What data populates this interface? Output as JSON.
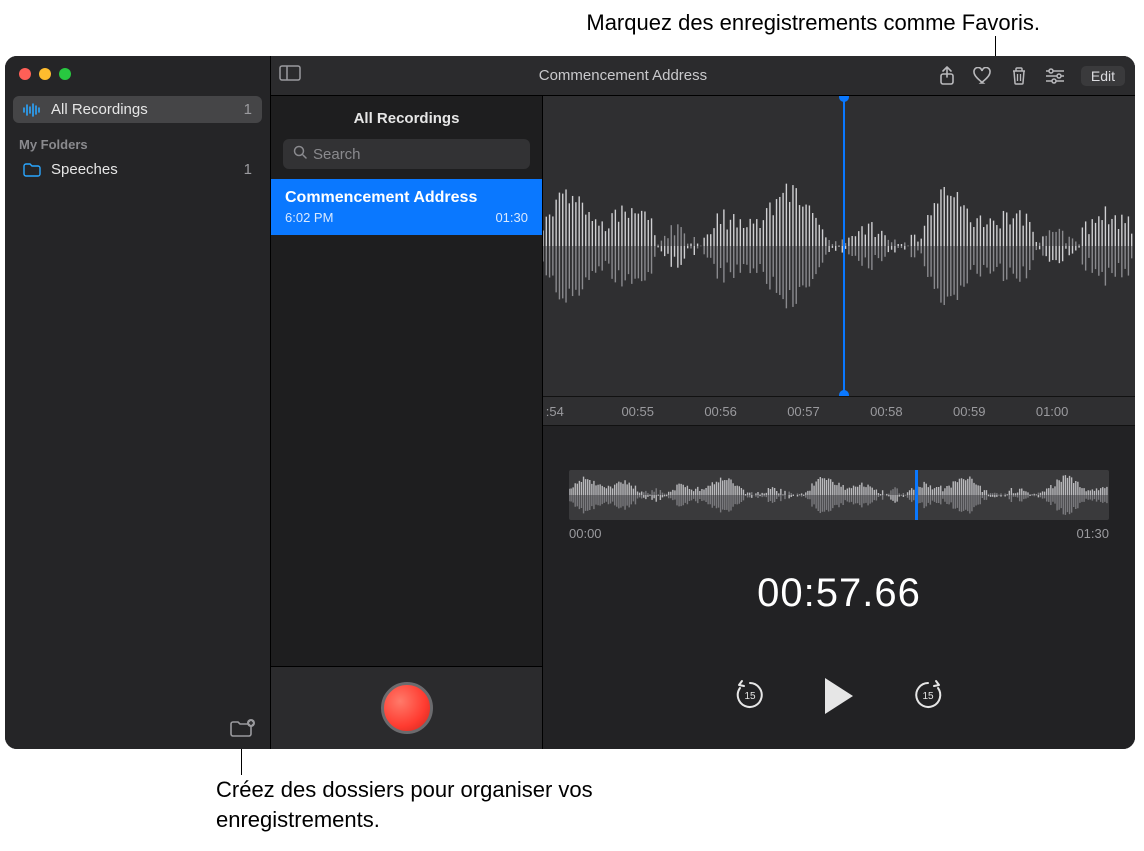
{
  "callouts": {
    "top": "Marquez des enregistrements comme Favoris.",
    "bottom": "Créez des dossiers pour organiser vos enregistrements."
  },
  "sidebar": {
    "all_label": "All Recordings",
    "all_count": "1",
    "section_label": "My Folders",
    "folder_label": "Speeches",
    "folder_count": "1"
  },
  "list": {
    "title": "All Recordings",
    "search_placeholder": "Search",
    "item": {
      "title": "Commencement Address",
      "time": "6:02 PM",
      "duration": "01:30"
    }
  },
  "titlebar": {
    "title": "Commencement Address",
    "edit": "Edit"
  },
  "timeline": {
    "t0": ":54",
    "t1": "00:55",
    "t2": "00:56",
    "t3": "00:57",
    "t4": "00:58",
    "t5": "00:59",
    "t6": "01:00"
  },
  "overview": {
    "start": "00:00",
    "end": "01:30"
  },
  "playback": {
    "time": "00:57.66"
  }
}
